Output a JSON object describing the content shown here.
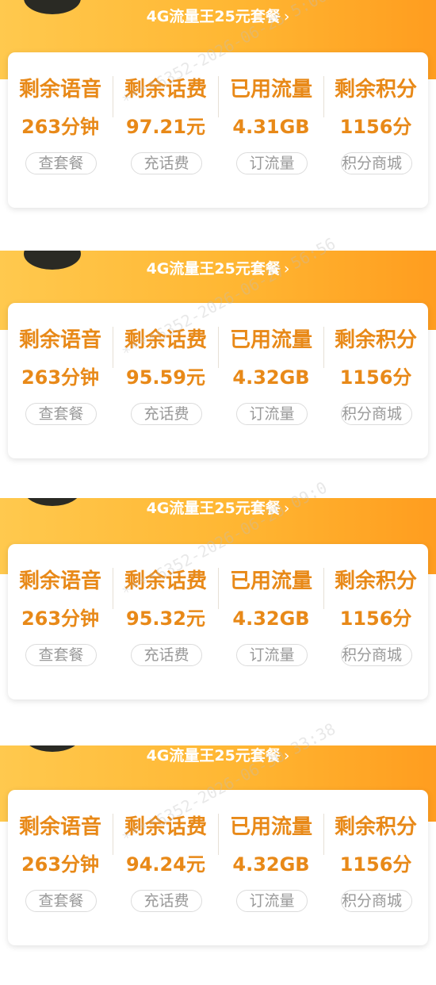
{
  "panels": [
    {
      "plan": "4G流量王25元套餐",
      "stats": [
        {
          "label": "剩余语音",
          "value": "263分钟",
          "button": "查套餐"
        },
        {
          "label": "剩余话费",
          "value": "97.21元",
          "button": "充话费"
        },
        {
          "label": "已用流量",
          "value": "4.31GB",
          "button": "订流量"
        },
        {
          "label": "剩余积分",
          "value": "1156分",
          "button": "积分商城"
        }
      ],
      "watermark": "****6352-2026-06-25 5:00"
    },
    {
      "plan": "4G流量王25元套餐",
      "stats": [
        {
          "label": "剩余语音",
          "value": "263分钟",
          "button": "查套餐"
        },
        {
          "label": "剩余话费",
          "value": "95.59元",
          "button": "充话费"
        },
        {
          "label": "已用流量",
          "value": "4.32GB",
          "button": "订流量"
        },
        {
          "label": "剩余积分",
          "value": "1156分",
          "button": "积分商城"
        }
      ],
      "watermark": "****6352-2026-06-27 56:56"
    },
    {
      "plan": "4G流量王25元套餐",
      "stats": [
        {
          "label": "剩余语音",
          "value": "263分钟",
          "button": "查套餐"
        },
        {
          "label": "剩余话费",
          "value": "95.32元",
          "button": "充话费"
        },
        {
          "label": "已用流量",
          "value": "4.32GB",
          "button": "订流量"
        },
        {
          "label": "剩余积分",
          "value": "1156分",
          "button": "积分商城"
        }
      ],
      "watermark": "****6352-2026-06-29 09:0"
    },
    {
      "plan": "4G流量王25元套餐",
      "stats": [
        {
          "label": "剩余语音",
          "value": "263分钟",
          "button": "查套餐"
        },
        {
          "label": "剩余话费",
          "value": "94.24元",
          "button": "充话费"
        },
        {
          "label": "已用流量",
          "value": "4.32GB",
          "button": "订流量"
        },
        {
          "label": "剩余积分",
          "value": "1156分",
          "button": "积分商城"
        }
      ],
      "watermark": "****6352-2026-06-30 33:38"
    }
  ]
}
